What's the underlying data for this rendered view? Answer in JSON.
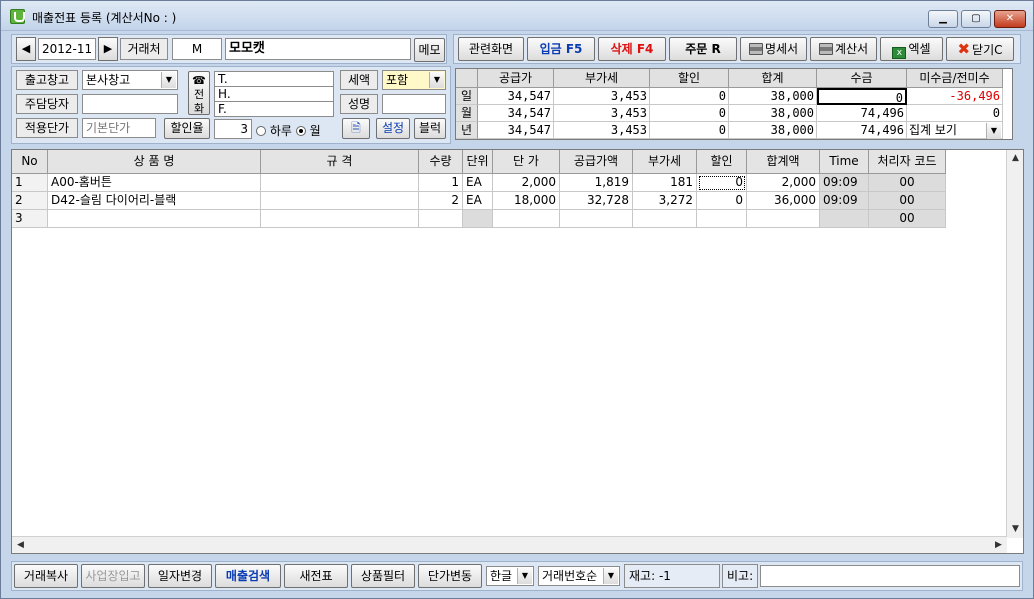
{
  "window": {
    "title": "매출전표 등록 (계산서No : )"
  },
  "header": {
    "date": "2012-11",
    "customer_label": "거래처",
    "customer_code": "M",
    "customer_name": "모모캣",
    "memo_button": "메모"
  },
  "toolbar": {
    "related": "관련화면",
    "deposit": "입금 F5",
    "delete": "삭제 F4",
    "order": "주문 R",
    "statement": "명세서",
    "invoice": "계산서",
    "excel": "엑셀",
    "close": "닫기C"
  },
  "info": {
    "warehouse_label": "출고창고",
    "warehouse_value": "본사창고",
    "manager_label": "주담당자",
    "manager_value": "",
    "price_label": "적용단가",
    "price_value": "기본단가",
    "discount_label": "할인율",
    "discount_value": "3",
    "per_day": "하루",
    "per_month": "월",
    "phone_label": "전화",
    "phone_t": "T.",
    "phone_h": "H.",
    "phone_f": "F.",
    "tax_label": "세액",
    "tax_value": "포함",
    "name_label": "성명",
    "name_value": "",
    "settings_button": "설정",
    "block_button": "블럭"
  },
  "summary": {
    "headers": [
      "공급가",
      "부가세",
      "할인",
      "합계",
      "수금",
      "미수금/전미수"
    ],
    "rows": [
      {
        "label": "일",
        "values": [
          "34,547",
          "3,453",
          "0",
          "38,000",
          "0",
          "-36,496"
        ]
      },
      {
        "label": "월",
        "values": [
          "34,547",
          "3,453",
          "0",
          "38,000",
          "74,496",
          "0"
        ]
      },
      {
        "label": "년",
        "values": [
          "34,547",
          "3,453",
          "0",
          "38,000",
          "74,496",
          "집계 보기"
        ]
      }
    ],
    "negative_color": "#e00000"
  },
  "grid": {
    "headers": [
      "No",
      "상 품 명",
      "규 격",
      "수량",
      "단위",
      "단 가",
      "공급가액",
      "부가세",
      "할인",
      "합계액",
      "Time",
      "처리자 코드"
    ],
    "rows": [
      [
        "1",
        "A00-홈버튼",
        "",
        "1",
        "EA",
        "2,000",
        "1,819",
        "181",
        "0",
        "2,000",
        "09:09",
        "00"
      ],
      [
        "2",
        "D42-슬림 다이어리-블랙",
        "",
        "2",
        "EA",
        "18,000",
        "32,728",
        "3,272",
        "0",
        "36,000",
        "09:09",
        "00"
      ],
      [
        "3",
        "",
        "",
        "",
        "",
        "",
        "",
        "",
        "",
        "",
        "",
        "00"
      ]
    ]
  },
  "footer": {
    "copy": "거래복사",
    "business": "사업장입고",
    "date_change": "일자변경",
    "sales_search": "매출검색",
    "new_slip": "새전표",
    "product_filter": "상품필터",
    "price_change": "단가변동",
    "lang": "한글",
    "sort": "거래번호순",
    "stock": "재고: -1",
    "remark_label": "비고:",
    "remark_value": ""
  }
}
